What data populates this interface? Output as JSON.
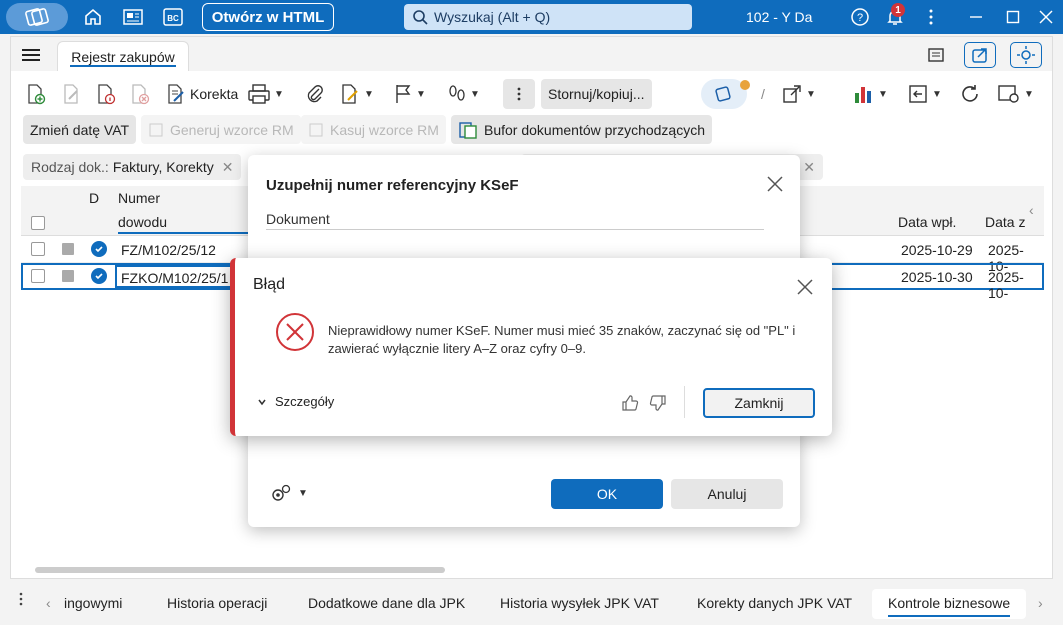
{
  "titlebar": {
    "html_button": "Otwórz w HTML",
    "search_placeholder": "Wyszukaj (Alt + Q)",
    "company": "102 - Y Da",
    "notifications": "1",
    "accent": "#0f6cbd"
  },
  "tabs": {
    "main": "Rejestr zakupów"
  },
  "toolbar": {
    "correction": "Korekta",
    "storno": "Stornuj/kopiuj...",
    "change_vat_date": "Zmień datę VAT",
    "generate_rm": "Generuj wzorce RM",
    "delete_rm": "Kasuj wzorce RM",
    "buffer": "Bufor dokumentów przychodzących"
  },
  "filter": {
    "label": "Rodzaj dok.:",
    "value": "Faktury, Korekty"
  },
  "grid": {
    "col_d": "D",
    "col_number_1": "Numer",
    "col_number_2": "dowodu",
    "col_date_in": "Data wpł.",
    "col_date_cut": "Data z",
    "rows": [
      {
        "number": "FZ/M102/25/12",
        "date_in": "2025-10-29",
        "date2": "2025-10-"
      },
      {
        "number": "FZKO/M102/25/1",
        "date_in": "2025-10-30",
        "date2": "2025-10-"
      }
    ]
  },
  "bottom_tabs": {
    "t1": "ingowymi",
    "t2": "Historia operacji",
    "t3": "Dodatkowe dane dla JPK",
    "t4": "Historia wysyłek JPK VAT",
    "t5": "Korekty danych JPK VAT",
    "t6": "Kontrole biznesowe"
  },
  "ksef_dialog": {
    "title": "Uzupełnij numer referencyjny  KSeF",
    "section": "Dokument",
    "ok": "OK",
    "cancel": "Anuluj"
  },
  "error_dialog": {
    "title": "Błąd",
    "message": "Nieprawidłowy numer KSeF. Numer musi mieć 35 znaków, zaczynać się od \"PL\" i zawierać wyłącznie litery A–Z oraz cyfry 0–9.",
    "details": "Szczegóły",
    "close": "Zamknij",
    "error_color": "#d13438"
  }
}
